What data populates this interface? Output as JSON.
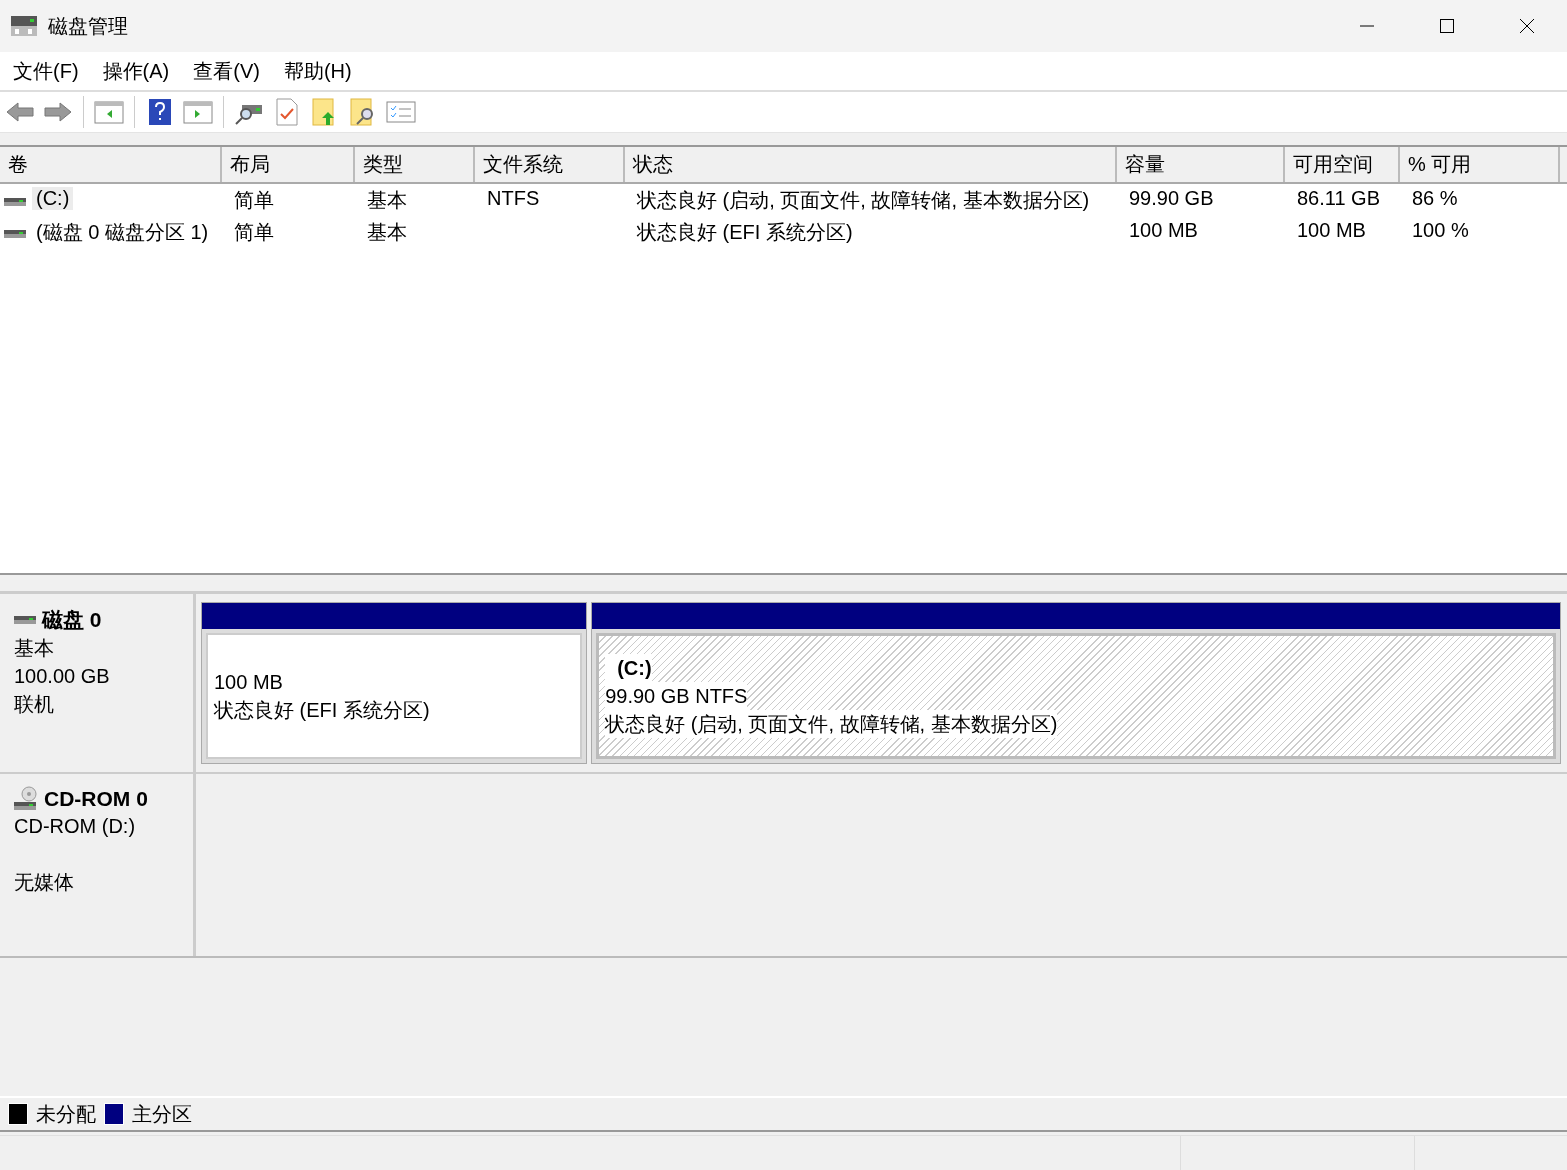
{
  "window": {
    "title": "磁盘管理"
  },
  "menu": [
    {
      "label": "文件(F)"
    },
    {
      "label": "操作(A)"
    },
    {
      "label": "查看(V)"
    },
    {
      "label": "帮助(H)"
    }
  ],
  "table": {
    "columns": [
      "卷",
      "布局",
      "类型",
      "文件系统",
      "状态",
      "容量",
      "可用空间",
      "% 可用"
    ],
    "rows": [
      {
        "selected": true,
        "cells": [
          "(C:)",
          "简单",
          "基本",
          "NTFS",
          "状态良好 (启动, 页面文件, 故障转储, 基本数据分区)",
          "99.90 GB",
          "86.11 GB",
          "86 %"
        ]
      },
      {
        "selected": false,
        "cells": [
          "(磁盘 0 磁盘分区 1)",
          "简单",
          "基本",
          "",
          "状态良好 (EFI 系统分区)",
          "100 MB",
          "100 MB",
          "100 %"
        ]
      }
    ]
  },
  "disks": [
    {
      "kind": "disk",
      "name": "磁盘 0",
      "type": "基本",
      "size": "100.00 GB",
      "status": "联机",
      "partitions": [
        {
          "selected": false,
          "size": "100 MB",
          "status": "状态良好 (EFI 系统分区)"
        },
        {
          "selected": true,
          "label": "(C:)",
          "size": "99.90 GB NTFS",
          "status": "状态良好 (启动, 页面文件, 故障转储, 基本数据分区)"
        }
      ]
    },
    {
      "kind": "cdrom",
      "name": "CD-ROM 0",
      "type": "CD-ROM (D:)",
      "status": "无媒体"
    }
  ],
  "legend": [
    {
      "label": "未分配",
      "color": "#000000"
    },
    {
      "label": "主分区",
      "color": "#000080"
    }
  ]
}
